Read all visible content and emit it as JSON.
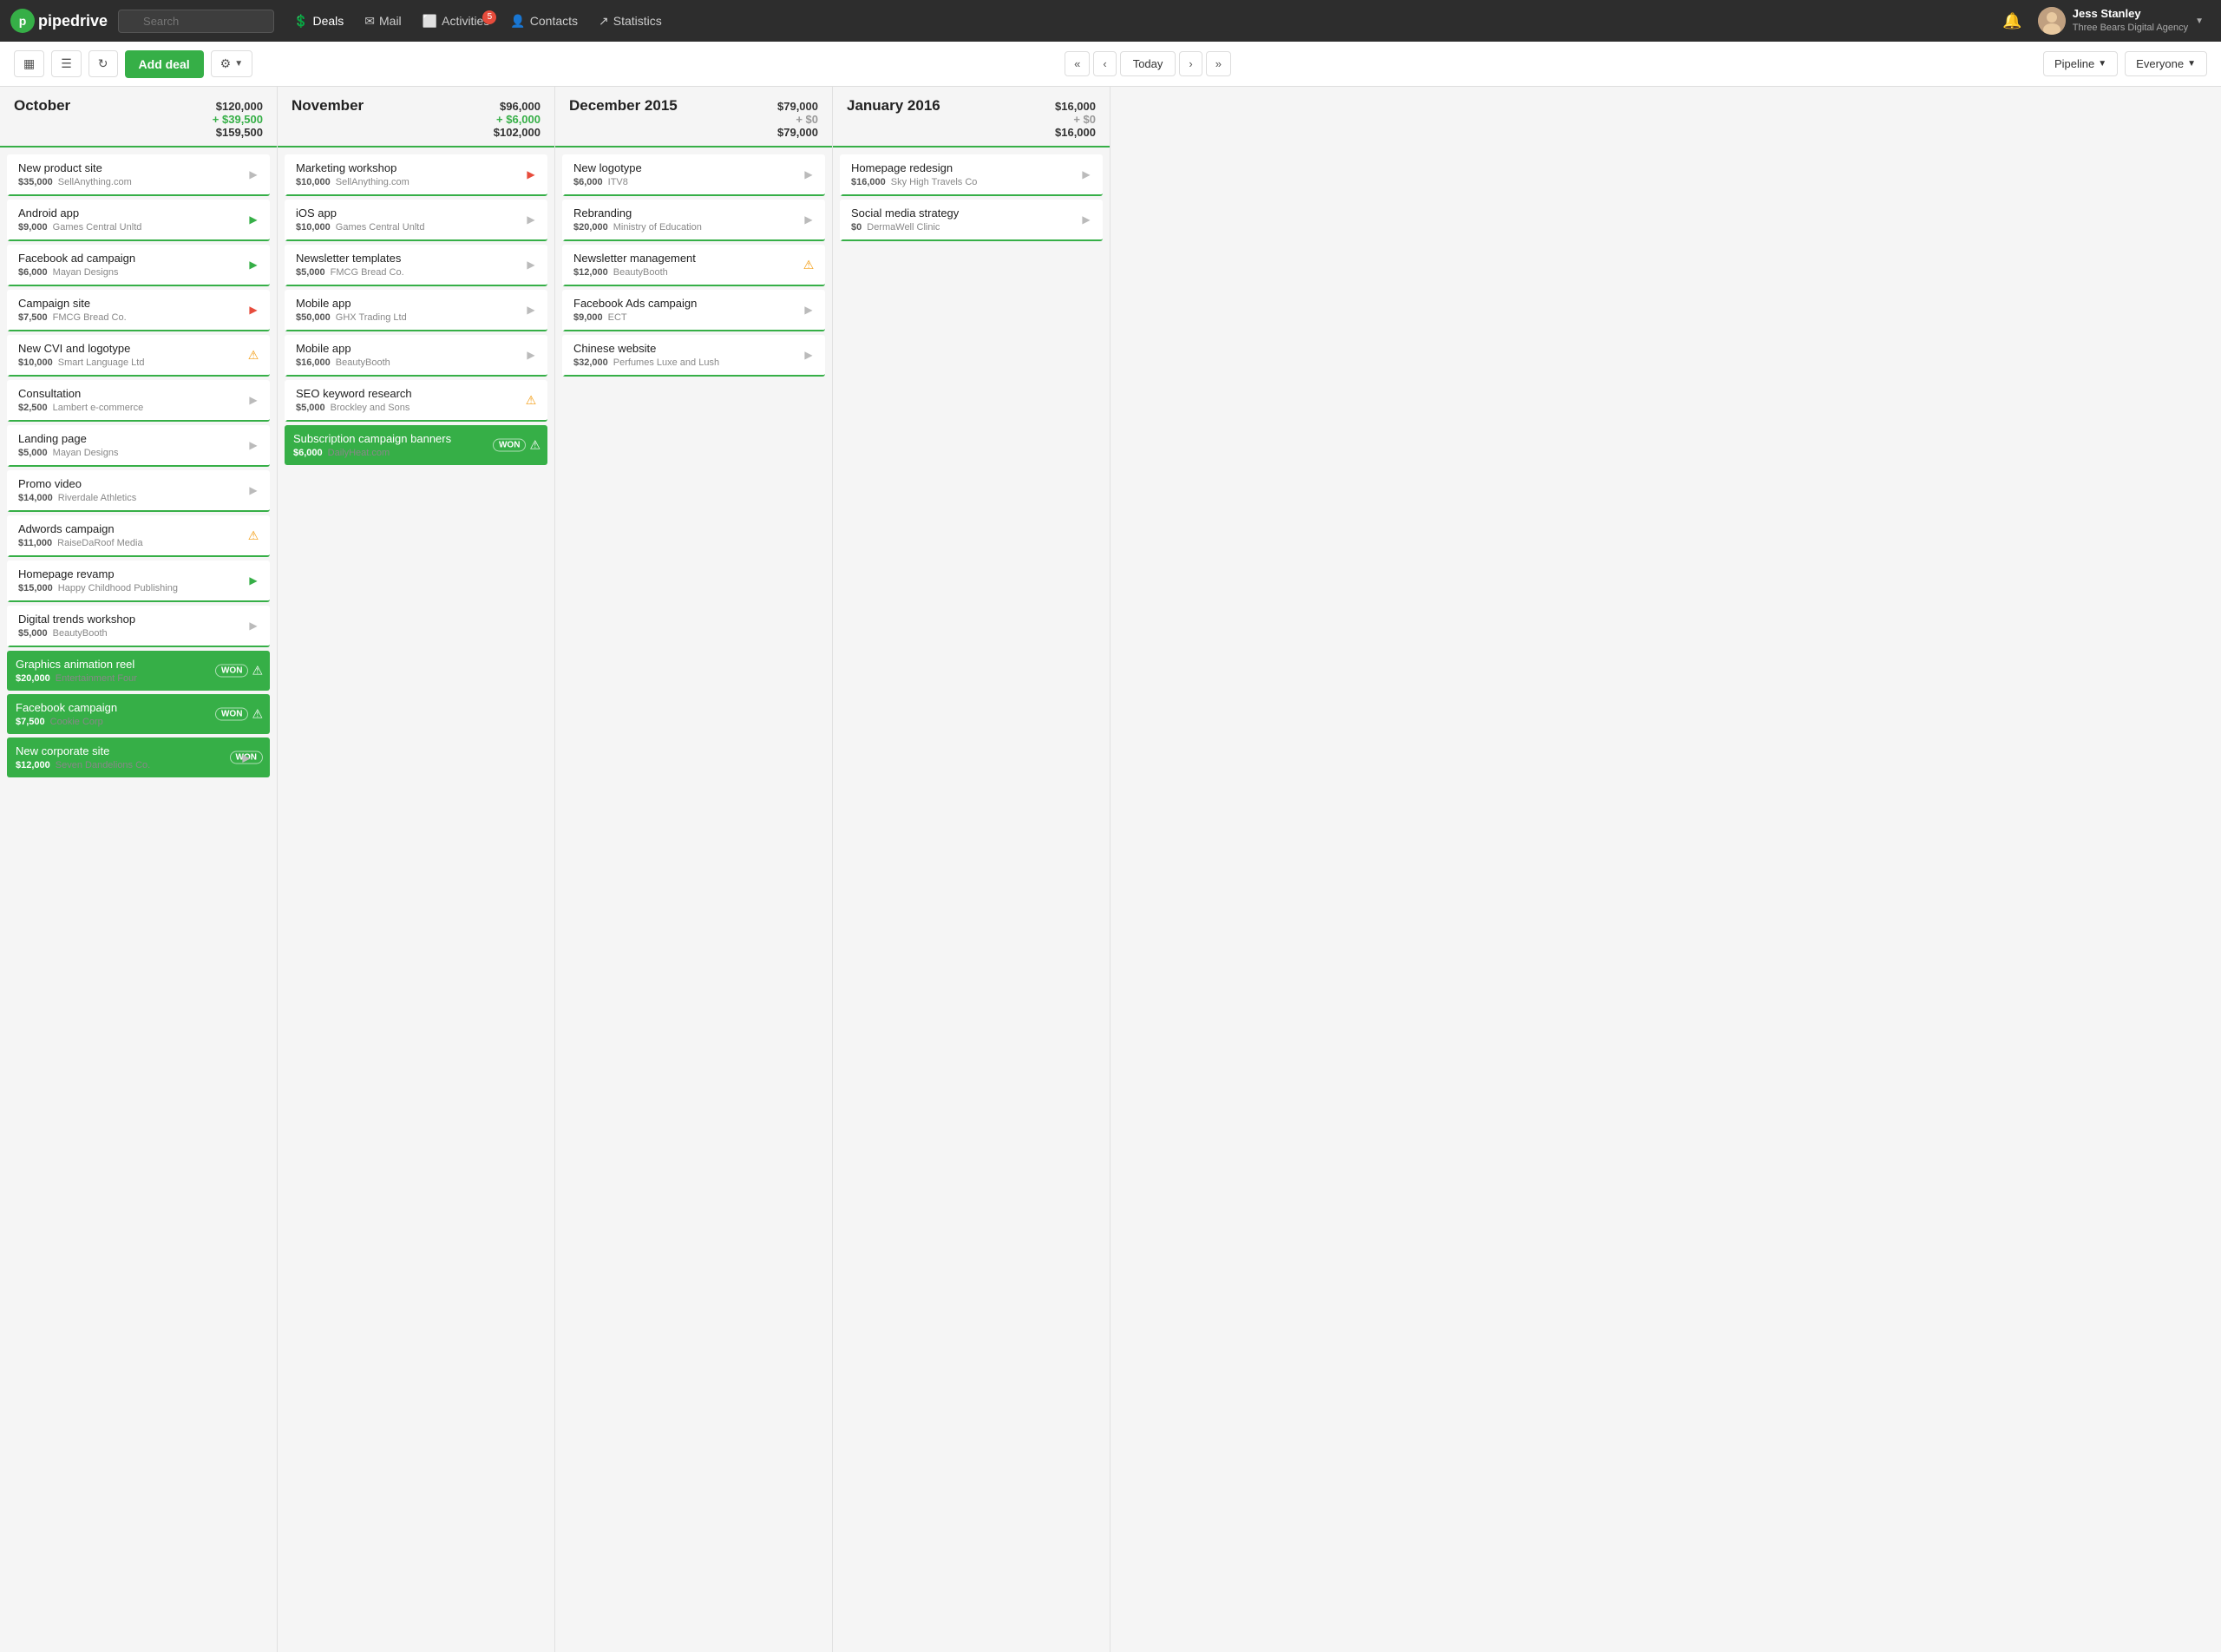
{
  "nav": {
    "logo_text": "pipedrive",
    "search_placeholder": "Search",
    "items": [
      {
        "id": "deals",
        "label": "Deals",
        "icon": "$",
        "active": true,
        "badge": null
      },
      {
        "id": "mail",
        "label": "Mail",
        "icon": "✉",
        "active": false,
        "badge": null
      },
      {
        "id": "activities",
        "label": "Activities",
        "icon": "◻",
        "active": false,
        "badge": "5"
      },
      {
        "id": "contacts",
        "label": "Contacts",
        "icon": "👤",
        "active": false,
        "badge": null
      },
      {
        "id": "statistics",
        "label": "Statistics",
        "icon": "↗",
        "active": false,
        "badge": null
      }
    ],
    "user_name": "Jess Stanley",
    "user_company": "Three Bears Digital Agency"
  },
  "toolbar": {
    "add_deal_label": "Add deal",
    "today_label": "Today",
    "pipeline_label": "Pipeline",
    "everyone_label": "Everyone"
  },
  "columns": [
    {
      "id": "october",
      "title": "October",
      "total": "$120,000",
      "delta": "+ $39,500",
      "delta_type": "pos",
      "subtotal": "$159,500",
      "deals": [
        {
          "id": 1,
          "title": "New product site",
          "amount": "$35,000",
          "company": "SellAnything.com",
          "action": "gray-circle",
          "won": false,
          "warn": false
        },
        {
          "id": 2,
          "title": "Android app",
          "amount": "$9,000",
          "company": "Games Central Unltd",
          "action": "green-circle",
          "won": false,
          "warn": false
        },
        {
          "id": 3,
          "title": "Facebook ad campaign",
          "amount": "$6,000",
          "company": "Mayan Designs",
          "action": "green-circle",
          "won": false,
          "warn": false
        },
        {
          "id": 4,
          "title": "Campaign site",
          "amount": "$7,500",
          "company": "FMCG Bread Co.",
          "action": "red-circle",
          "won": false,
          "warn": false
        },
        {
          "id": 5,
          "title": "New CVI and logotype",
          "amount": "$10,000",
          "company": "Smart Language Ltd",
          "action": "warn",
          "won": false,
          "warn": true
        },
        {
          "id": 6,
          "title": "Consultation",
          "amount": "$2,500",
          "company": "Lambert e-commerce",
          "action": "gray-circle",
          "won": false,
          "warn": false
        },
        {
          "id": 7,
          "title": "Landing page",
          "amount": "$5,000",
          "company": "Mayan Designs",
          "action": "gray-circle",
          "won": false,
          "warn": false
        },
        {
          "id": 8,
          "title": "Promo video",
          "amount": "$14,000",
          "company": "Riverdale Athletics",
          "action": "gray-circle",
          "won": false,
          "warn": false
        },
        {
          "id": 9,
          "title": "Adwords campaign",
          "amount": "$11,000",
          "company": "RaiseDaRoof Media",
          "action": "warn",
          "won": false,
          "warn": true
        },
        {
          "id": 10,
          "title": "Homepage revamp",
          "amount": "$15,000",
          "company": "Happy Childhood Publishing",
          "action": "green-circle",
          "won": false,
          "warn": false
        },
        {
          "id": 11,
          "title": "Digital trends workshop",
          "amount": "$5,000",
          "company": "BeautyBooth",
          "action": "gray-circle",
          "won": false,
          "warn": false
        },
        {
          "id": 12,
          "title": "Graphics animation reel",
          "amount": "$20,000",
          "company": "Entertainment Four",
          "action": "won-warn",
          "won": true,
          "warn": true
        },
        {
          "id": 13,
          "title": "Facebook campaign",
          "amount": "$7,500",
          "company": "Cookie Corp",
          "action": "won-warn",
          "won": true,
          "warn": true
        },
        {
          "id": 14,
          "title": "New corporate site",
          "amount": "$12,000",
          "company": "Seven Dandelions Co.",
          "action": "won-circle",
          "won": true,
          "warn": false
        }
      ]
    },
    {
      "id": "november",
      "title": "November",
      "total": "$96,000",
      "delta": "+ $6,000",
      "delta_type": "pos",
      "subtotal": "$102,000",
      "deals": [
        {
          "id": 20,
          "title": "Marketing workshop",
          "amount": "$10,000",
          "company": "SellAnything.com",
          "action": "red-circle",
          "won": false,
          "warn": false
        },
        {
          "id": 21,
          "title": "iOS app",
          "amount": "$10,000",
          "company": "Games Central Unltd",
          "action": "gray-circle",
          "won": false,
          "warn": false
        },
        {
          "id": 22,
          "title": "Newsletter templates",
          "amount": "$5,000",
          "company": "FMCG Bread Co.",
          "action": "gray-circle",
          "won": false,
          "warn": false
        },
        {
          "id": 23,
          "title": "Mobile app",
          "amount": "$50,000",
          "company": "GHX Trading Ltd",
          "action": "gray-circle",
          "won": false,
          "warn": false
        },
        {
          "id": 24,
          "title": "Mobile app",
          "amount": "$16,000",
          "company": "BeautyBooth",
          "action": "gray-circle",
          "won": false,
          "warn": false
        },
        {
          "id": 25,
          "title": "SEO keyword research",
          "amount": "$5,000",
          "company": "Brockley and Sons",
          "action": "warn",
          "won": false,
          "warn": true
        },
        {
          "id": 26,
          "title": "Subscription campaign banners",
          "amount": "$6,000",
          "company": "DailyHeat.com",
          "action": "won-warn",
          "won": true,
          "warn": true
        }
      ]
    },
    {
      "id": "december",
      "title": "December 2015",
      "total": "$79,000",
      "delta": "+ $0",
      "delta_type": "zero",
      "subtotal": "$79,000",
      "deals": [
        {
          "id": 30,
          "title": "New logotype",
          "amount": "$6,000",
          "company": "ITV8",
          "action": "gray-circle",
          "won": false,
          "warn": false
        },
        {
          "id": 31,
          "title": "Rebranding",
          "amount": "$20,000",
          "company": "Ministry of Education",
          "action": "gray-circle",
          "won": false,
          "warn": false
        },
        {
          "id": 32,
          "title": "Newsletter management",
          "amount": "$12,000",
          "company": "BeautyBooth",
          "action": "warn",
          "won": false,
          "warn": true
        },
        {
          "id": 33,
          "title": "Facebook Ads campaign",
          "amount": "$9,000",
          "company": "ECT",
          "action": "gray-circle",
          "won": false,
          "warn": false
        },
        {
          "id": 34,
          "title": "Chinese website",
          "amount": "$32,000",
          "company": "Perfumes Luxe and Lush",
          "action": "gray-circle",
          "won": false,
          "warn": false
        }
      ]
    },
    {
      "id": "january",
      "title": "January 2016",
      "total": "$16,000",
      "delta": "+ $0",
      "delta_type": "zero",
      "subtotal": "$16,000",
      "deals": [
        {
          "id": 40,
          "title": "Homepage redesign",
          "amount": "$16,000",
          "company": "Sky High Travels Co",
          "action": "gray-circle",
          "won": false,
          "warn": false
        },
        {
          "id": 41,
          "title": "Social media strategy",
          "amount": "$0",
          "company": "DermaWell Clinic",
          "action": "gray-circle",
          "won": false,
          "warn": false
        }
      ]
    }
  ]
}
